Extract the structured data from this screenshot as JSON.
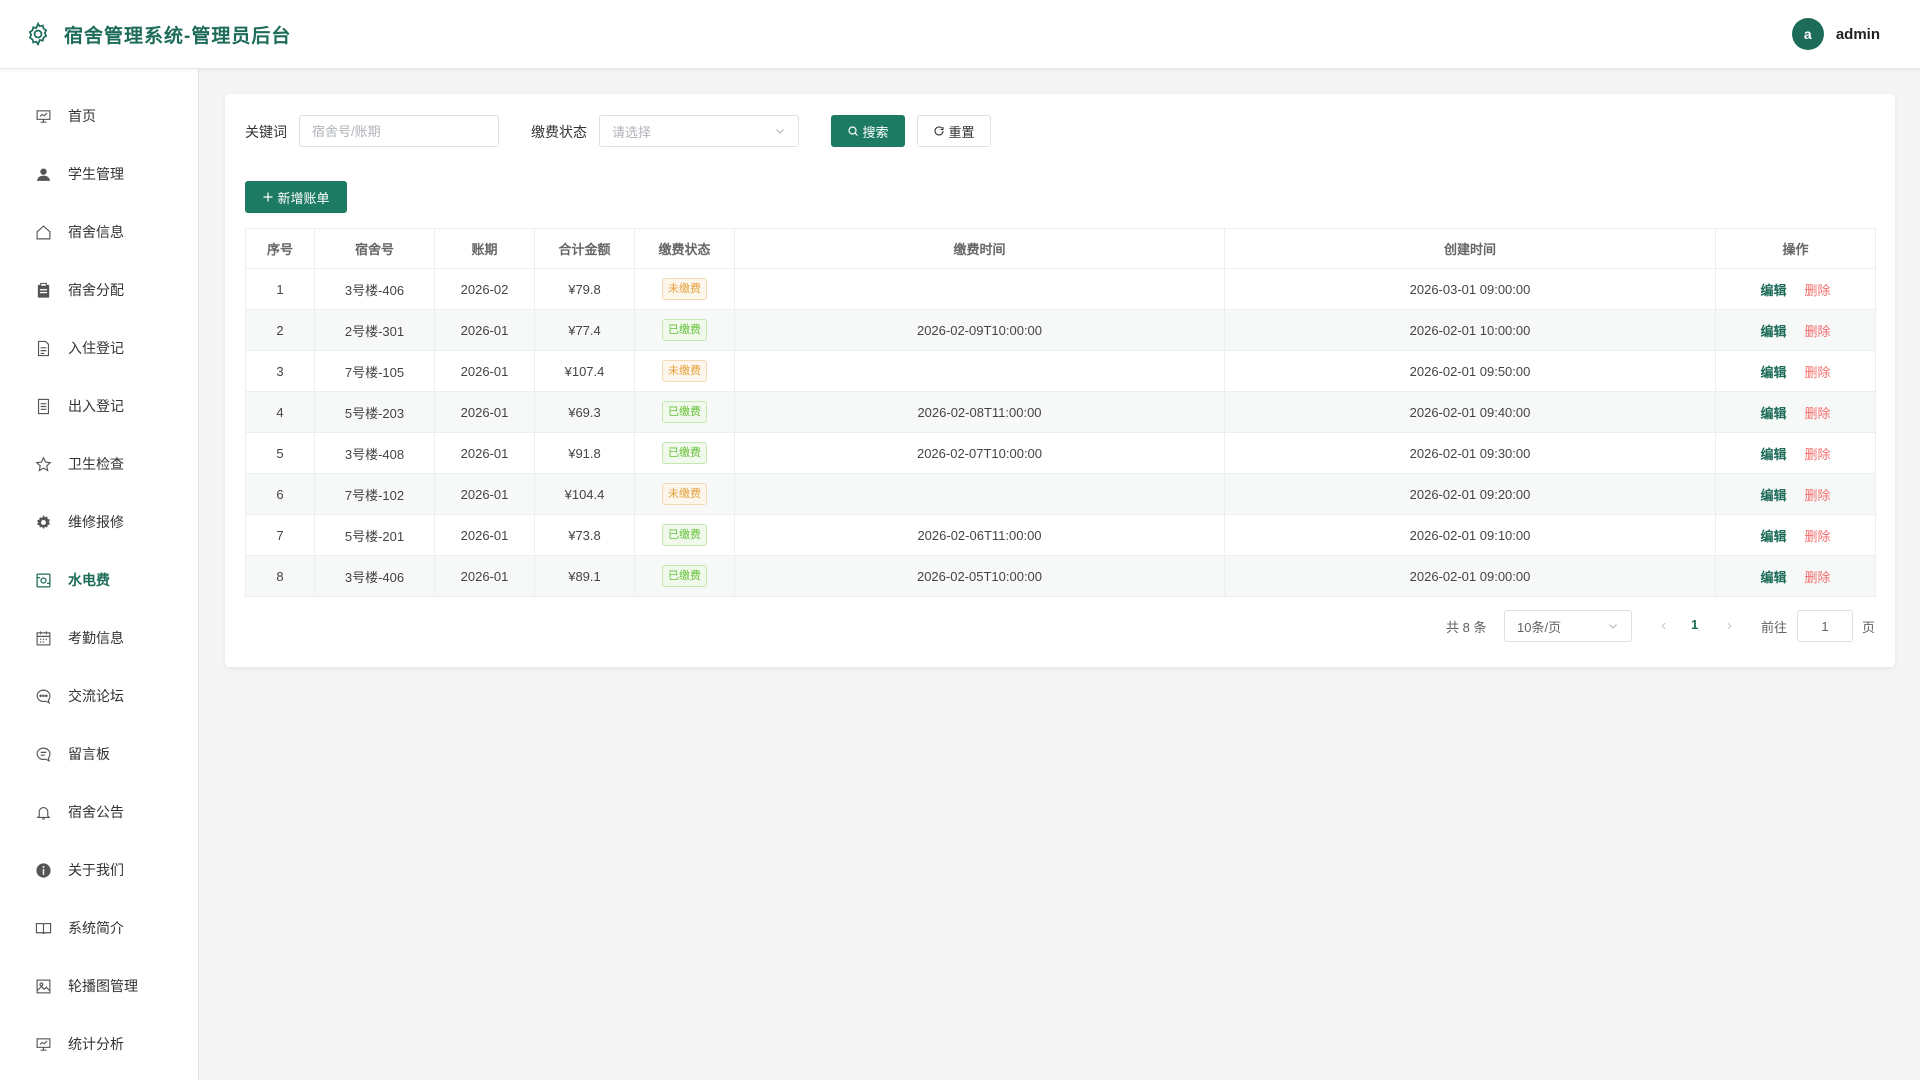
{
  "header": {
    "title": "宿舍管理系统-管理员后台",
    "user_initial": "a",
    "username": "admin"
  },
  "sidebar": {
    "items": [
      {
        "label": "首页",
        "icon": "chart-board-icon"
      },
      {
        "label": "学生管理",
        "icon": "user-icon"
      },
      {
        "label": "宿舍信息",
        "icon": "home-icon"
      },
      {
        "label": "宿舍分配",
        "icon": "clipboard-icon"
      },
      {
        "label": "入住登记",
        "icon": "document-icon"
      },
      {
        "label": "出入登记",
        "icon": "document-list-icon"
      },
      {
        "label": "卫生检查",
        "icon": "star-icon"
      },
      {
        "label": "维修报修",
        "icon": "gear-icon"
      },
      {
        "label": "水电费",
        "icon": "money-icon",
        "active": true
      },
      {
        "label": "考勤信息",
        "icon": "calendar-icon"
      },
      {
        "label": "交流论坛",
        "icon": "chat-dots-icon"
      },
      {
        "label": "留言板",
        "icon": "chat-lines-icon"
      },
      {
        "label": "宿舍公告",
        "icon": "bell-icon"
      },
      {
        "label": "关于我们",
        "icon": "info-icon"
      },
      {
        "label": "系统简介",
        "icon": "book-icon"
      },
      {
        "label": "轮播图管理",
        "icon": "picture-icon"
      },
      {
        "label": "统计分析",
        "icon": "chart-board-icon"
      }
    ]
  },
  "filter": {
    "keyword_label": "关键词",
    "keyword_placeholder": "宿舍号/账期",
    "status_label": "缴费状态",
    "status_placeholder": "请选择",
    "search_label": "搜索",
    "reset_label": "重置",
    "add_label": "新增账单"
  },
  "table": {
    "columns": [
      "序号",
      "宿舍号",
      "账期",
      "合计金额",
      "缴费状态",
      "缴费时间",
      "创建时间",
      "操作"
    ],
    "edit_label": "编辑",
    "delete_label": "删除",
    "rows": [
      {
        "no": "1",
        "room": "3号楼-406",
        "period": "2026-02",
        "amount": "¥79.8",
        "status": "未缴费",
        "paid": false,
        "pay_time": "",
        "created": "2026-03-01 09:00:00"
      },
      {
        "no": "2",
        "room": "2号楼-301",
        "period": "2026-01",
        "amount": "¥77.4",
        "status": "已缴费",
        "paid": true,
        "pay_time": "2026-02-09T10:00:00",
        "created": "2026-02-01 10:00:00"
      },
      {
        "no": "3",
        "room": "7号楼-105",
        "period": "2026-01",
        "amount": "¥107.4",
        "status": "未缴费",
        "paid": false,
        "pay_time": "",
        "created": "2026-02-01 09:50:00"
      },
      {
        "no": "4",
        "room": "5号楼-203",
        "period": "2026-01",
        "amount": "¥69.3",
        "status": "已缴费",
        "paid": true,
        "pay_time": "2026-02-08T11:00:00",
        "created": "2026-02-01 09:40:00"
      },
      {
        "no": "5",
        "room": "3号楼-408",
        "period": "2026-01",
        "amount": "¥91.8",
        "status": "已缴费",
        "paid": true,
        "pay_time": "2026-02-07T10:00:00",
        "created": "2026-02-01 09:30:00"
      },
      {
        "no": "6",
        "room": "7号楼-102",
        "period": "2026-01",
        "amount": "¥104.4",
        "status": "未缴费",
        "paid": false,
        "pay_time": "",
        "created": "2026-02-01 09:20:00"
      },
      {
        "no": "7",
        "room": "5号楼-201",
        "period": "2026-01",
        "amount": "¥73.8",
        "status": "已缴费",
        "paid": true,
        "pay_time": "2026-02-06T11:00:00",
        "created": "2026-02-01 09:10:00"
      },
      {
        "no": "8",
        "room": "3号楼-406",
        "period": "2026-01",
        "amount": "¥89.1",
        "status": "已缴费",
        "paid": true,
        "pay_time": "2026-02-05T10:00:00",
        "created": "2026-02-01 09:00:00"
      }
    ]
  },
  "pagination": {
    "total_text": "共 8 条",
    "page_size": "10条/页",
    "current_page": "1",
    "goto_label": "前往",
    "goto_value": "1",
    "page_suffix": "页"
  },
  "colors": {
    "brand": "#1d6b59",
    "primary_button": "#1d7a63",
    "unpaid": "#e6a23c",
    "paid": "#67c23a",
    "delete": "#f56c6c"
  }
}
